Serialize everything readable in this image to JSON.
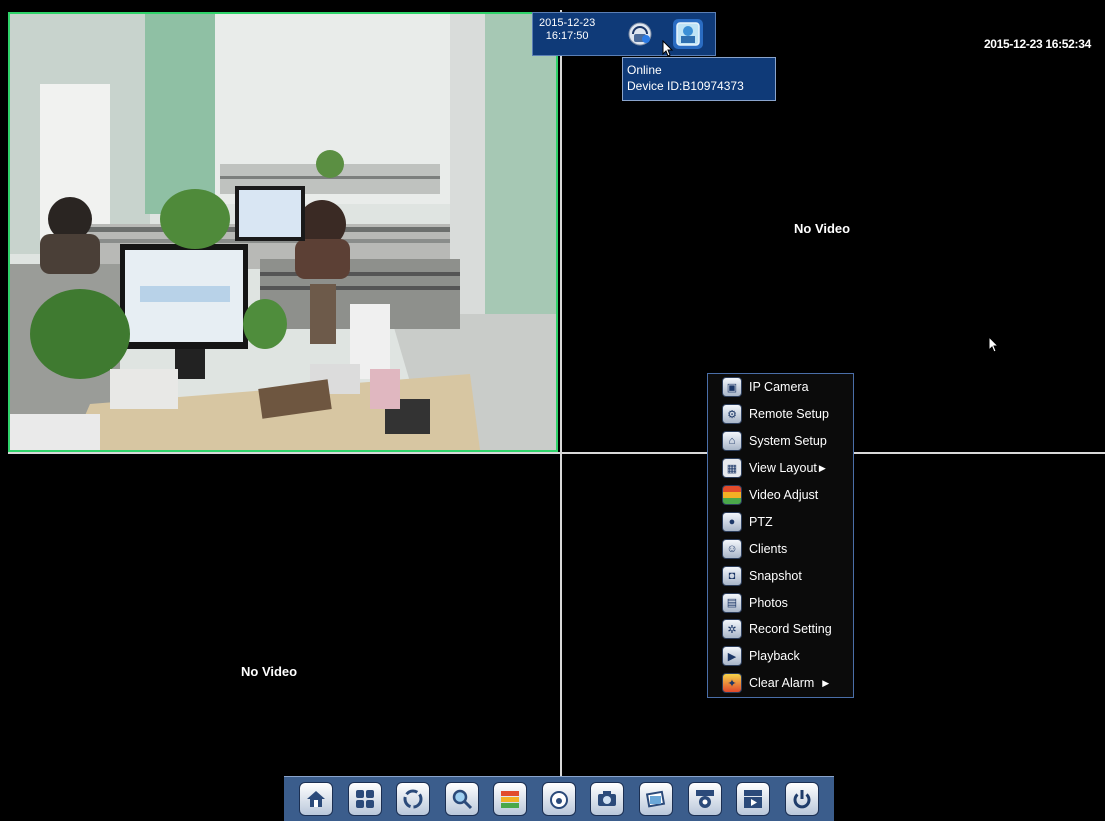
{
  "osd": {
    "timestamp": "2015-12-23 16:52:34"
  },
  "status_widget": {
    "date": "2015-12-23",
    "time": "16:17:50",
    "icons": [
      "network-icon",
      "device-icon"
    ]
  },
  "tooltip": {
    "line1": "Online",
    "line2": "Device ID:B10974373"
  },
  "channels": [
    {
      "name": "channel-1",
      "status": ""
    },
    {
      "name": "channel-2",
      "status": "No Video"
    },
    {
      "name": "channel-3",
      "status": "No Video"
    },
    {
      "name": "channel-4",
      "status": ""
    }
  ],
  "context_menu": {
    "items": [
      {
        "label": "IP Camera",
        "icon": "ip-camera-icon",
        "submenu": false
      },
      {
        "label": "Remote Setup",
        "icon": "remote-setup-icon",
        "submenu": false
      },
      {
        "label": "System Setup",
        "icon": "system-setup-icon",
        "submenu": false
      },
      {
        "label": "View Layout",
        "icon": "view-layout-icon",
        "submenu": true
      },
      {
        "label": "Video Adjust",
        "icon": "video-adjust-icon",
        "submenu": false
      },
      {
        "label": "PTZ",
        "icon": "ptz-icon",
        "submenu": false
      },
      {
        "label": "Clients",
        "icon": "clients-icon",
        "submenu": false
      },
      {
        "label": "Snapshot",
        "icon": "snapshot-icon",
        "submenu": false
      },
      {
        "label": "Photos",
        "icon": "photos-icon",
        "submenu": false
      },
      {
        "label": "Record Setting",
        "icon": "record-setting-icon",
        "submenu": false
      },
      {
        "label": "Playback",
        "icon": "playback-icon",
        "submenu": false
      },
      {
        "label": "Clear Alarm",
        "icon": "clear-alarm-icon",
        "submenu": true
      }
    ]
  },
  "toolbar": {
    "buttons": [
      "home-setup-icon",
      "layout-icon",
      "sequence-icon",
      "zoom-icon",
      "video-adjust-icon",
      "ptz-icon",
      "snapshot-icon",
      "photos-icon",
      "record-setting-icon",
      "playback-icon",
      "power-icon"
    ]
  },
  "colors": {
    "selected_channel_border": "#2fd36a",
    "panel_blue": "#0f3a78",
    "toolbar_blue": "#3b5d8c",
    "grid_line": "#d8d8d8"
  }
}
